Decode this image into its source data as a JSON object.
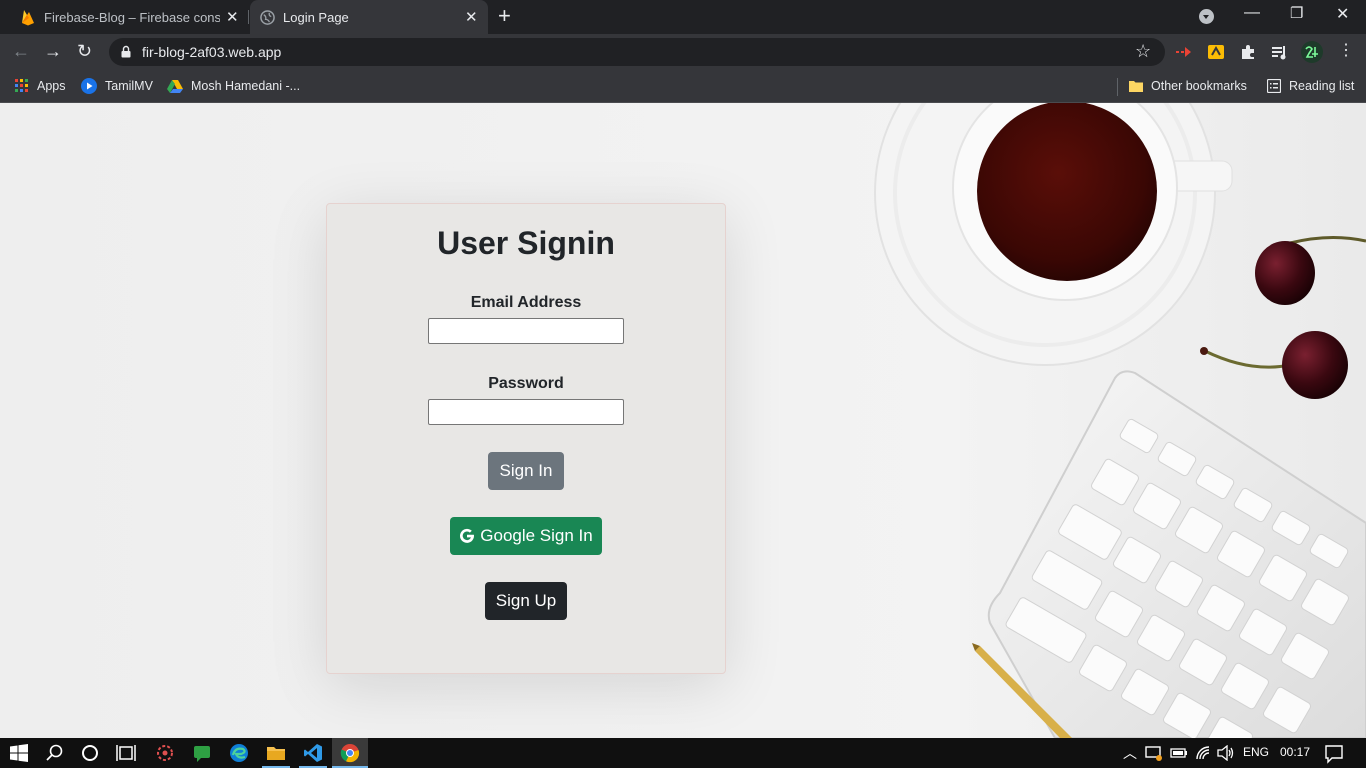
{
  "browser": {
    "tabs": [
      {
        "title": "Firebase-Blog – Firebase console",
        "favicon": "firebase-icon"
      },
      {
        "title": "Login Page",
        "favicon": "globe-icon",
        "active": true
      }
    ],
    "url": "fir-blog-2af03.web.app",
    "bookmarks": [
      {
        "label": "Apps",
        "icon": "apps-grid-icon"
      },
      {
        "label": "TamilMV",
        "icon": "play-icon"
      },
      {
        "label": "Mosh Hamedani -...",
        "icon": "google-drive-icon"
      }
    ],
    "other_bookmarks": "Other bookmarks",
    "reading_list": "Reading list"
  },
  "login": {
    "title": "User Signin",
    "email_label": "Email Address",
    "email_value": "",
    "password_label": "Password",
    "password_value": "",
    "signin_label": "Sign In",
    "google_label": "Google Sign In",
    "signup_label": "Sign Up"
  },
  "colors": {
    "signin_button": "#6c757d",
    "google_button": "#198754",
    "signup_button": "#212529"
  },
  "taskbar": {
    "language": "ENG",
    "time": "00:17"
  }
}
